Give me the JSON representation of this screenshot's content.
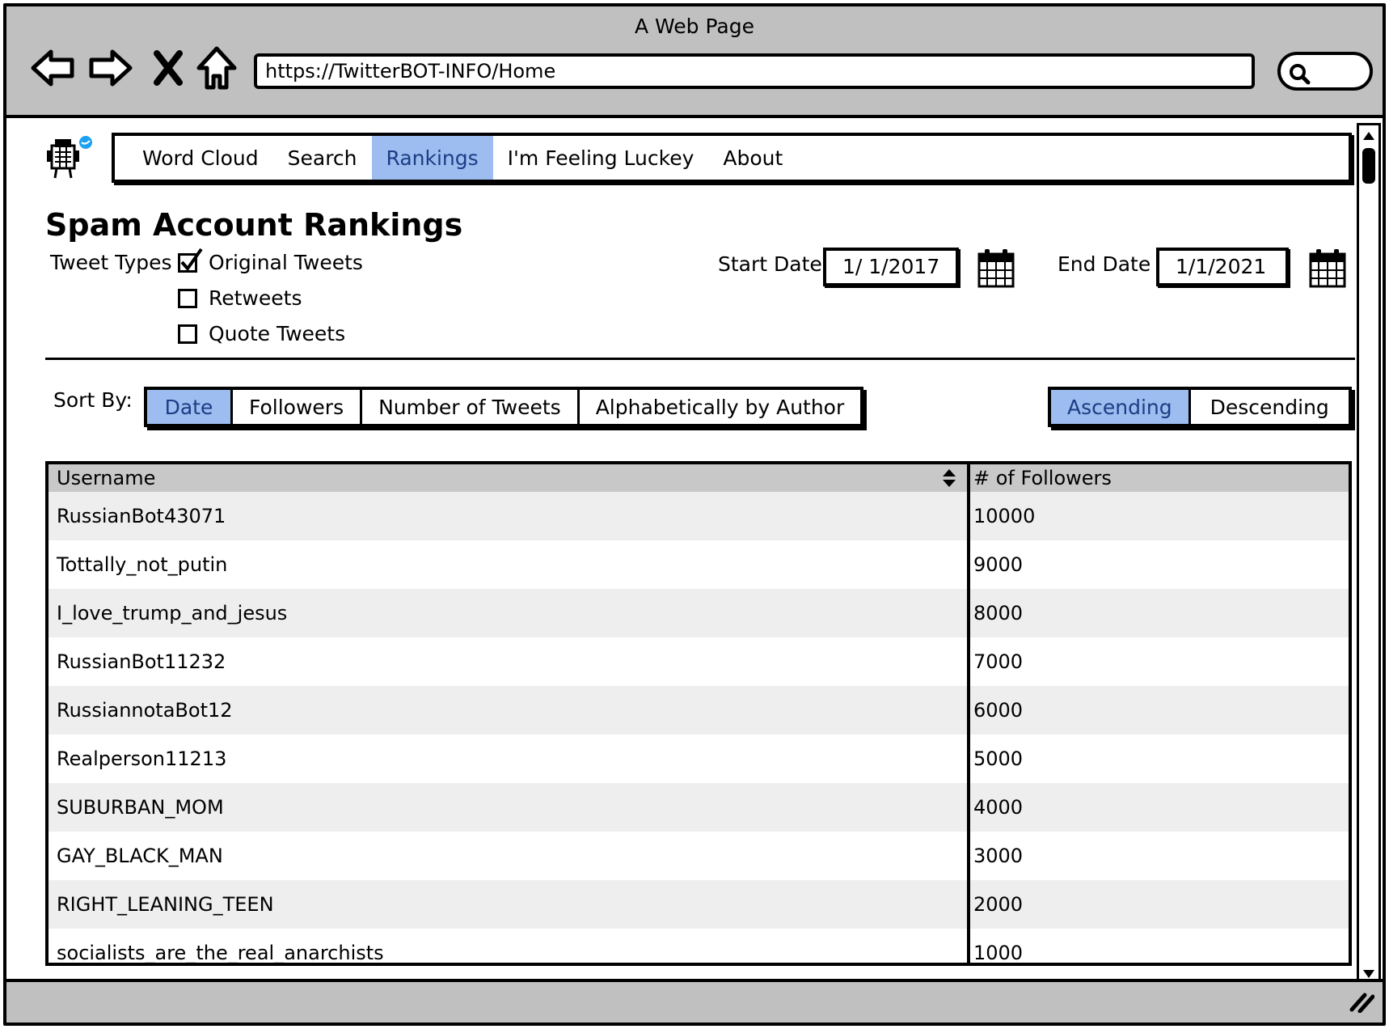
{
  "window": {
    "title": "A Web Page",
    "url": "https://TwitterBOT-INFO/Home"
  },
  "nav": {
    "tabs": [
      {
        "label": "Word Cloud",
        "active": false
      },
      {
        "label": "Search",
        "active": false
      },
      {
        "label": "Rankings",
        "active": true
      },
      {
        "label": "I'm Feeling Luckey",
        "active": false
      },
      {
        "label": "About",
        "active": false
      }
    ]
  },
  "page": {
    "title": "Spam Account Rankings",
    "tweet_types_label": "Tweet Types",
    "tweet_types": [
      {
        "label": "Original Tweets",
        "checked": true
      },
      {
        "label": "Retweets",
        "checked": false
      },
      {
        "label": "Quote Tweets",
        "checked": false
      }
    ],
    "start_date_label": "Start Date",
    "start_date": "1/ 1/2017",
    "end_date_label": "End Date",
    "end_date": "1/1/2021"
  },
  "sort": {
    "label": "Sort By:",
    "options": [
      {
        "label": "Date",
        "active": true
      },
      {
        "label": "Followers",
        "active": false
      },
      {
        "label": "Number of Tweets",
        "active": false
      },
      {
        "label": "Alphabetically by Author",
        "active": false
      }
    ],
    "order": [
      {
        "label": "Ascending",
        "active": true
      },
      {
        "label": "Descending",
        "active": false
      }
    ]
  },
  "table": {
    "columns": [
      "Username",
      "# of Followers"
    ],
    "rows": [
      [
        "RussianBot43071",
        "10000"
      ],
      [
        "Tottally_not_putin",
        "9000"
      ],
      [
        "I_love_trump_and_jesus",
        "8000"
      ],
      [
        "RussianBot11232",
        "7000"
      ],
      [
        "RussiannotaBot12",
        "6000"
      ],
      [
        "Realperson11213",
        "5000"
      ],
      [
        "SUBURBAN_MOM",
        "4000"
      ],
      [
        "GAY_BLACK_MAN",
        "3000"
      ],
      [
        "RIGHT_LEANING_TEEN",
        "2000"
      ],
      [
        "socialists_are_the_real_anarchists",
        "1000"
      ]
    ]
  },
  "colors": {
    "active_tab": "#9dbcef",
    "active_text": "#1a3e86",
    "chrome": "#c0c0c0",
    "row_alt": "#eeeeee",
    "badge": "#1da1f2"
  },
  "icons": [
    "back-arrow-icon",
    "forward-arrow-icon",
    "close-icon",
    "home-icon",
    "search-icon",
    "robot-logo-icon",
    "twitter-bird-icon",
    "calendar-icon",
    "sort-updown-icon",
    "scroll-up-icon",
    "scroll-down-icon",
    "resize-grip-icon"
  ]
}
